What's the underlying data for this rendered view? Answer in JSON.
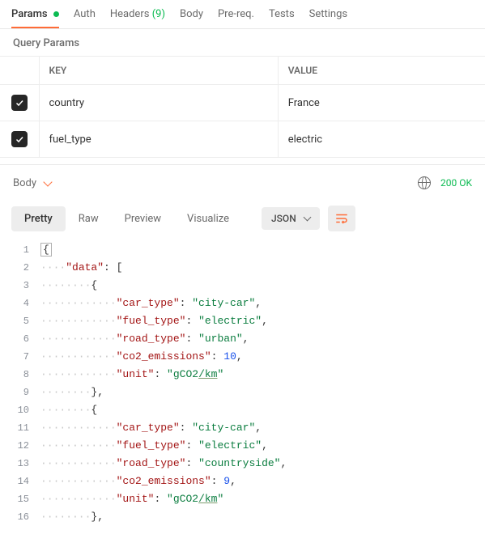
{
  "tabs": {
    "params": "Params",
    "auth": "Auth",
    "headers_label": "Headers",
    "headers_count": "(9)",
    "body": "Body",
    "prereq": "Pre-req.",
    "tests": "Tests",
    "settings": "Settings"
  },
  "section_title": "Query Params",
  "table": {
    "key_header": "KEY",
    "value_header": "VALUE",
    "rows": [
      {
        "checked": true,
        "key": "country",
        "value": "France"
      },
      {
        "checked": true,
        "key": "fuel_type",
        "value": "electric"
      }
    ]
  },
  "response_bar": {
    "body_label": "Body",
    "status": "200 OK"
  },
  "view_tabs": {
    "pretty": "Pretty",
    "raw": "Raw",
    "preview": "Preview",
    "visualize": "Visualize",
    "json": "JSON"
  },
  "code": {
    "lines": [
      {
        "n": 1,
        "indent": 0,
        "tokens": [
          [
            "brace",
            "{"
          ]
        ]
      },
      {
        "n": 2,
        "indent": 1,
        "tokens": [
          [
            "key",
            "\"data\""
          ],
          [
            "punc",
            ": ["
          ]
        ]
      },
      {
        "n": 3,
        "indent": 2,
        "tokens": [
          [
            "punc",
            "{"
          ]
        ]
      },
      {
        "n": 4,
        "indent": 3,
        "tokens": [
          [
            "key",
            "\"car_type\""
          ],
          [
            "punc",
            ": "
          ],
          [
            "str",
            "\"city-car\""
          ],
          [
            "punc",
            ","
          ]
        ]
      },
      {
        "n": 5,
        "indent": 3,
        "tokens": [
          [
            "key",
            "\"fuel_type\""
          ],
          [
            "punc",
            ": "
          ],
          [
            "str",
            "\"electric\""
          ],
          [
            "punc",
            ","
          ]
        ]
      },
      {
        "n": 6,
        "indent": 3,
        "tokens": [
          [
            "key",
            "\"road_type\""
          ],
          [
            "punc",
            ": "
          ],
          [
            "str",
            "\"urban\""
          ],
          [
            "punc",
            ","
          ]
        ]
      },
      {
        "n": 7,
        "indent": 3,
        "tokens": [
          [
            "key",
            "\"co2_emissions\""
          ],
          [
            "punc",
            ": "
          ],
          [
            "num",
            "10"
          ],
          [
            "punc",
            ","
          ]
        ]
      },
      {
        "n": 8,
        "indent": 3,
        "tokens": [
          [
            "key",
            "\"unit\""
          ],
          [
            "punc",
            ": "
          ],
          [
            "str",
            "\"gCO2"
          ],
          [
            "stru",
            "/km"
          ],
          [
            "str",
            "\""
          ]
        ]
      },
      {
        "n": 9,
        "indent": 2,
        "tokens": [
          [
            "punc",
            "},"
          ]
        ]
      },
      {
        "n": 10,
        "indent": 2,
        "tokens": [
          [
            "punc",
            "{"
          ]
        ]
      },
      {
        "n": 11,
        "indent": 3,
        "tokens": [
          [
            "key",
            "\"car_type\""
          ],
          [
            "punc",
            ": "
          ],
          [
            "str",
            "\"city-car\""
          ],
          [
            "punc",
            ","
          ]
        ]
      },
      {
        "n": 12,
        "indent": 3,
        "tokens": [
          [
            "key",
            "\"fuel_type\""
          ],
          [
            "punc",
            ": "
          ],
          [
            "str",
            "\"electric\""
          ],
          [
            "punc",
            ","
          ]
        ]
      },
      {
        "n": 13,
        "indent": 3,
        "tokens": [
          [
            "key",
            "\"road_type\""
          ],
          [
            "punc",
            ": "
          ],
          [
            "str",
            "\"countryside\""
          ],
          [
            "punc",
            ","
          ]
        ]
      },
      {
        "n": 14,
        "indent": 3,
        "tokens": [
          [
            "key",
            "\"co2_emissions\""
          ],
          [
            "punc",
            ": "
          ],
          [
            "num",
            "9"
          ],
          [
            "punc",
            ","
          ]
        ]
      },
      {
        "n": 15,
        "indent": 3,
        "tokens": [
          [
            "key",
            "\"unit\""
          ],
          [
            "punc",
            ": "
          ],
          [
            "str",
            "\"gCO2"
          ],
          [
            "stru",
            "/km"
          ],
          [
            "str",
            "\""
          ]
        ]
      },
      {
        "n": 16,
        "indent": 2,
        "tokens": [
          [
            "punc",
            "},"
          ]
        ]
      }
    ]
  }
}
